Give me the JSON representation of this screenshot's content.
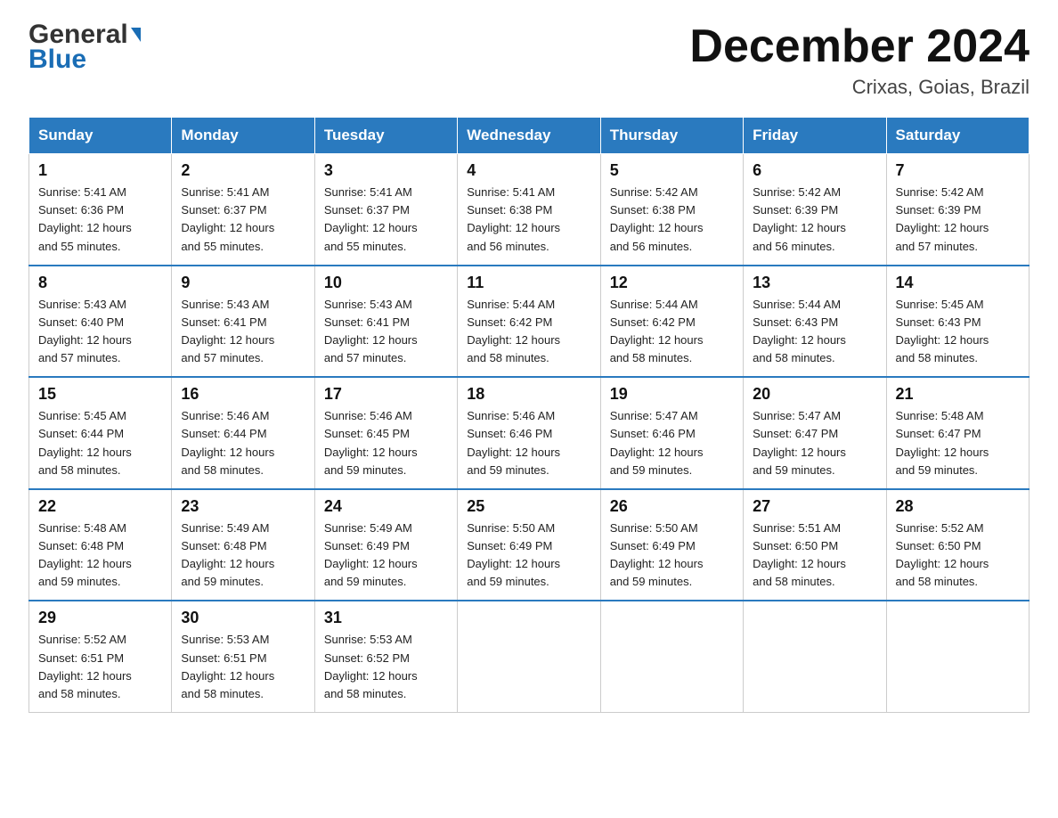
{
  "header": {
    "logo_general": "General",
    "logo_blue": "Blue",
    "month_title": "December 2024",
    "location": "Crixas, Goias, Brazil"
  },
  "weekdays": [
    "Sunday",
    "Monday",
    "Tuesday",
    "Wednesday",
    "Thursday",
    "Friday",
    "Saturday"
  ],
  "weeks": [
    [
      {
        "day": "1",
        "sunrise": "5:41 AM",
        "sunset": "6:36 PM",
        "daylight": "12 hours and 55 minutes."
      },
      {
        "day": "2",
        "sunrise": "5:41 AM",
        "sunset": "6:37 PM",
        "daylight": "12 hours and 55 minutes."
      },
      {
        "day": "3",
        "sunrise": "5:41 AM",
        "sunset": "6:37 PM",
        "daylight": "12 hours and 55 minutes."
      },
      {
        "day": "4",
        "sunrise": "5:41 AM",
        "sunset": "6:38 PM",
        "daylight": "12 hours and 56 minutes."
      },
      {
        "day": "5",
        "sunrise": "5:42 AM",
        "sunset": "6:38 PM",
        "daylight": "12 hours and 56 minutes."
      },
      {
        "day": "6",
        "sunrise": "5:42 AM",
        "sunset": "6:39 PM",
        "daylight": "12 hours and 56 minutes."
      },
      {
        "day": "7",
        "sunrise": "5:42 AM",
        "sunset": "6:39 PM",
        "daylight": "12 hours and 57 minutes."
      }
    ],
    [
      {
        "day": "8",
        "sunrise": "5:43 AM",
        "sunset": "6:40 PM",
        "daylight": "12 hours and 57 minutes."
      },
      {
        "day": "9",
        "sunrise": "5:43 AM",
        "sunset": "6:41 PM",
        "daylight": "12 hours and 57 minutes."
      },
      {
        "day": "10",
        "sunrise": "5:43 AM",
        "sunset": "6:41 PM",
        "daylight": "12 hours and 57 minutes."
      },
      {
        "day": "11",
        "sunrise": "5:44 AM",
        "sunset": "6:42 PM",
        "daylight": "12 hours and 58 minutes."
      },
      {
        "day": "12",
        "sunrise": "5:44 AM",
        "sunset": "6:42 PM",
        "daylight": "12 hours and 58 minutes."
      },
      {
        "day": "13",
        "sunrise": "5:44 AM",
        "sunset": "6:43 PM",
        "daylight": "12 hours and 58 minutes."
      },
      {
        "day": "14",
        "sunrise": "5:45 AM",
        "sunset": "6:43 PM",
        "daylight": "12 hours and 58 minutes."
      }
    ],
    [
      {
        "day": "15",
        "sunrise": "5:45 AM",
        "sunset": "6:44 PM",
        "daylight": "12 hours and 58 minutes."
      },
      {
        "day": "16",
        "sunrise": "5:46 AM",
        "sunset": "6:44 PM",
        "daylight": "12 hours and 58 minutes."
      },
      {
        "day": "17",
        "sunrise": "5:46 AM",
        "sunset": "6:45 PM",
        "daylight": "12 hours and 59 minutes."
      },
      {
        "day": "18",
        "sunrise": "5:46 AM",
        "sunset": "6:46 PM",
        "daylight": "12 hours and 59 minutes."
      },
      {
        "day": "19",
        "sunrise": "5:47 AM",
        "sunset": "6:46 PM",
        "daylight": "12 hours and 59 minutes."
      },
      {
        "day": "20",
        "sunrise": "5:47 AM",
        "sunset": "6:47 PM",
        "daylight": "12 hours and 59 minutes."
      },
      {
        "day": "21",
        "sunrise": "5:48 AM",
        "sunset": "6:47 PM",
        "daylight": "12 hours and 59 minutes."
      }
    ],
    [
      {
        "day": "22",
        "sunrise": "5:48 AM",
        "sunset": "6:48 PM",
        "daylight": "12 hours and 59 minutes."
      },
      {
        "day": "23",
        "sunrise": "5:49 AM",
        "sunset": "6:48 PM",
        "daylight": "12 hours and 59 minutes."
      },
      {
        "day": "24",
        "sunrise": "5:49 AM",
        "sunset": "6:49 PM",
        "daylight": "12 hours and 59 minutes."
      },
      {
        "day": "25",
        "sunrise": "5:50 AM",
        "sunset": "6:49 PM",
        "daylight": "12 hours and 59 minutes."
      },
      {
        "day": "26",
        "sunrise": "5:50 AM",
        "sunset": "6:49 PM",
        "daylight": "12 hours and 59 minutes."
      },
      {
        "day": "27",
        "sunrise": "5:51 AM",
        "sunset": "6:50 PM",
        "daylight": "12 hours and 58 minutes."
      },
      {
        "day": "28",
        "sunrise": "5:52 AM",
        "sunset": "6:50 PM",
        "daylight": "12 hours and 58 minutes."
      }
    ],
    [
      {
        "day": "29",
        "sunrise": "5:52 AM",
        "sunset": "6:51 PM",
        "daylight": "12 hours and 58 minutes."
      },
      {
        "day": "30",
        "sunrise": "5:53 AM",
        "sunset": "6:51 PM",
        "daylight": "12 hours and 58 minutes."
      },
      {
        "day": "31",
        "sunrise": "5:53 AM",
        "sunset": "6:52 PM",
        "daylight": "12 hours and 58 minutes."
      },
      null,
      null,
      null,
      null
    ]
  ]
}
